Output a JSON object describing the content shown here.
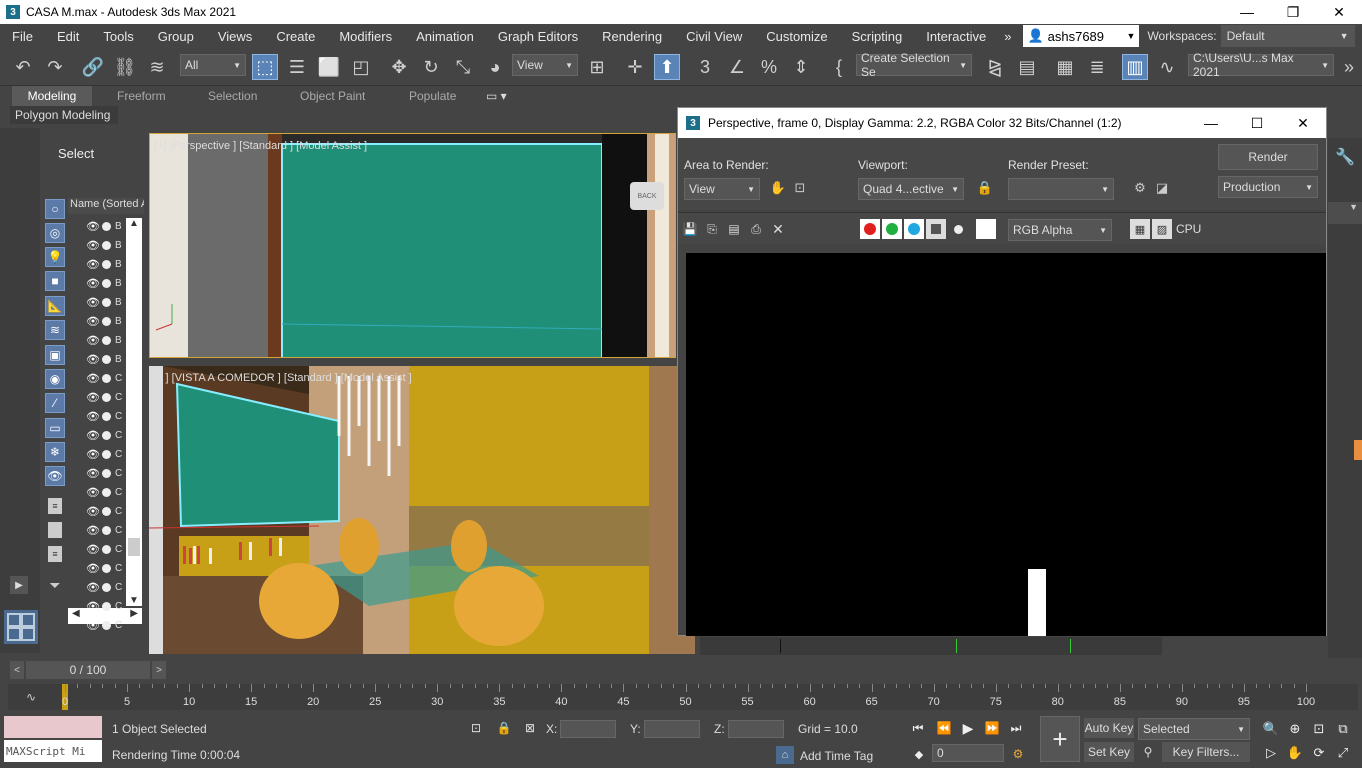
{
  "app": {
    "title": "CASA M.max - Autodesk 3ds Max 2021",
    "min": "—",
    "max": "❐",
    "close": "✕"
  },
  "menu": [
    "File",
    "Edit",
    "Tools",
    "Group",
    "Views",
    "Create",
    "Modifiers",
    "Animation",
    "Graph Editors",
    "Rendering",
    "Civil View",
    "Customize",
    "Scripting",
    "Interactive"
  ],
  "user": {
    "name": "ashs7689"
  },
  "workspaces": {
    "label": "Workspaces:",
    "value": "Default"
  },
  "toolbar": {
    "selection_filter": "All",
    "ref_coord": "View",
    "named_selection": "Create Selection Se",
    "project_path": "C:\\Users\\U...s Max 2021"
  },
  "ribbon": {
    "tabs": [
      "Modeling",
      "Freeform",
      "Selection",
      "Object Paint",
      "Populate"
    ],
    "active": "Modeling",
    "sub": "Polygon Modeling"
  },
  "scene_explorer": {
    "select_label": "Select",
    "column_header": "Name (Sorted A",
    "rows": [
      "B",
      "B",
      "B",
      "B",
      "B",
      "B",
      "B",
      "B",
      "C",
      "C",
      "C",
      "C",
      "C",
      "C",
      "C",
      "C",
      "C",
      "C",
      "C",
      "C",
      "C",
      "C"
    ]
  },
  "viewports": {
    "top_label": "[+] [Perspective ] [Standard ] [Model Assist ]",
    "bottom_label": "[+ ] [VISTA A COMEDOR ] [Standard ] [Model Assist ]",
    "back_label": "BACK"
  },
  "render_window": {
    "title": "Perspective, frame 0, Display Gamma: 2.2, RGBA Color 32 Bits/Channel (1:2)",
    "area_label": "Area to Render:",
    "area_value": "View",
    "viewport_label": "Viewport:",
    "viewport_value": "Quad 4...ective",
    "preset_label": "Render Preset:",
    "render_button": "Render",
    "production": "Production",
    "channel": "RGB Alpha",
    "cpu": "CPU",
    "colors": {
      "red": "#e02020",
      "green": "#20b040",
      "blue": "#20a8e0"
    }
  },
  "timeline": {
    "frame_range": "0 / 100",
    "ticks": [
      "0",
      "5",
      "10",
      "15",
      "20",
      "25",
      "30",
      "35",
      "40",
      "45",
      "50",
      "55",
      "60",
      "65",
      "70",
      "75",
      "80",
      "85",
      "90",
      "95",
      "100"
    ]
  },
  "status": {
    "maxscript": "MAXScript Mi",
    "selected": "1 Object Selected",
    "render_time": "Rendering Time  0:00:04",
    "x_label": "X:",
    "y_label": "Y:",
    "z_label": "Z:",
    "grid": "Grid = 10.0",
    "add_time_tag": "Add Time Tag",
    "auto_key": "Auto Key",
    "set_key": "Set Key",
    "selected_dropdown": "Selected",
    "key_filters": "Key Filters...",
    "frame": "0"
  }
}
